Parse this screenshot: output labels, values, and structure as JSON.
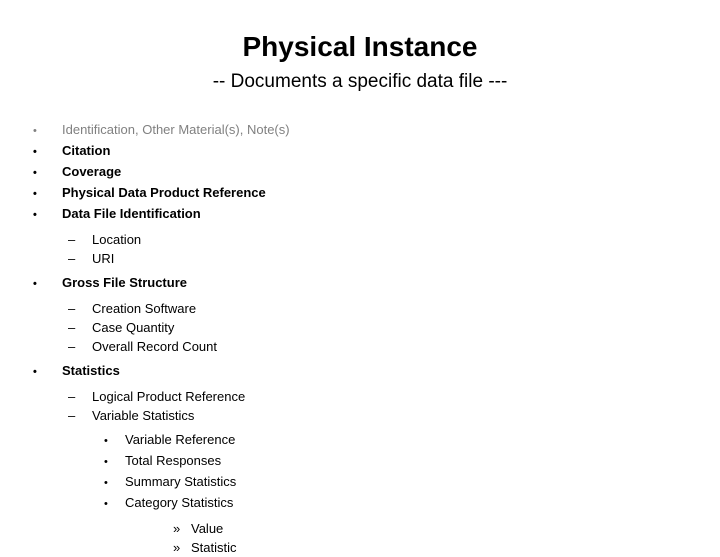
{
  "slide": {
    "title": "Physical Instance",
    "subtitle": "-- Documents a specific data file ---",
    "colors": {
      "background": "#ffffff",
      "text": "#000000",
      "muted_text": "#808080"
    },
    "markers": {
      "level1": "•",
      "level2": "–",
      "level3": "•",
      "level4": "»"
    },
    "outline": [
      {
        "level": 1,
        "text": "Identification, Other Material(s), Note(s)",
        "style": "muted"
      },
      {
        "level": 1,
        "text": "Citation",
        "style": "bold"
      },
      {
        "level": 1,
        "text": "Coverage",
        "style": "bold"
      },
      {
        "level": 1,
        "text": "Physical Data Product Reference",
        "style": "bold"
      },
      {
        "level": 1,
        "text": "Data File Identification",
        "style": "bold"
      },
      {
        "level": 2,
        "text": "Location",
        "style": "normal"
      },
      {
        "level": 2,
        "text": "URI",
        "style": "normal"
      },
      {
        "level": 1,
        "text": "Gross File Structure",
        "style": "bold"
      },
      {
        "level": 2,
        "text": "Creation Software",
        "style": "normal"
      },
      {
        "level": 2,
        "text": "Case Quantity",
        "style": "normal"
      },
      {
        "level": 2,
        "text": "Overall Record Count",
        "style": "normal"
      },
      {
        "level": 1,
        "text": "Statistics",
        "style": "bold"
      },
      {
        "level": 2,
        "text": "Logical Product Reference",
        "style": "normal"
      },
      {
        "level": 2,
        "text": "Variable Statistics",
        "style": "normal"
      },
      {
        "level": 3,
        "text": "Variable Reference",
        "style": "normal"
      },
      {
        "level": 3,
        "text": "Total Responses",
        "style": "normal"
      },
      {
        "level": 3,
        "text": "Summary Statistics",
        "style": "normal"
      },
      {
        "level": 3,
        "text": "Category Statistics",
        "style": "normal"
      },
      {
        "level": 4,
        "text": "Value",
        "style": "normal"
      },
      {
        "level": 4,
        "text": "Statistic",
        "style": "normal"
      }
    ]
  }
}
